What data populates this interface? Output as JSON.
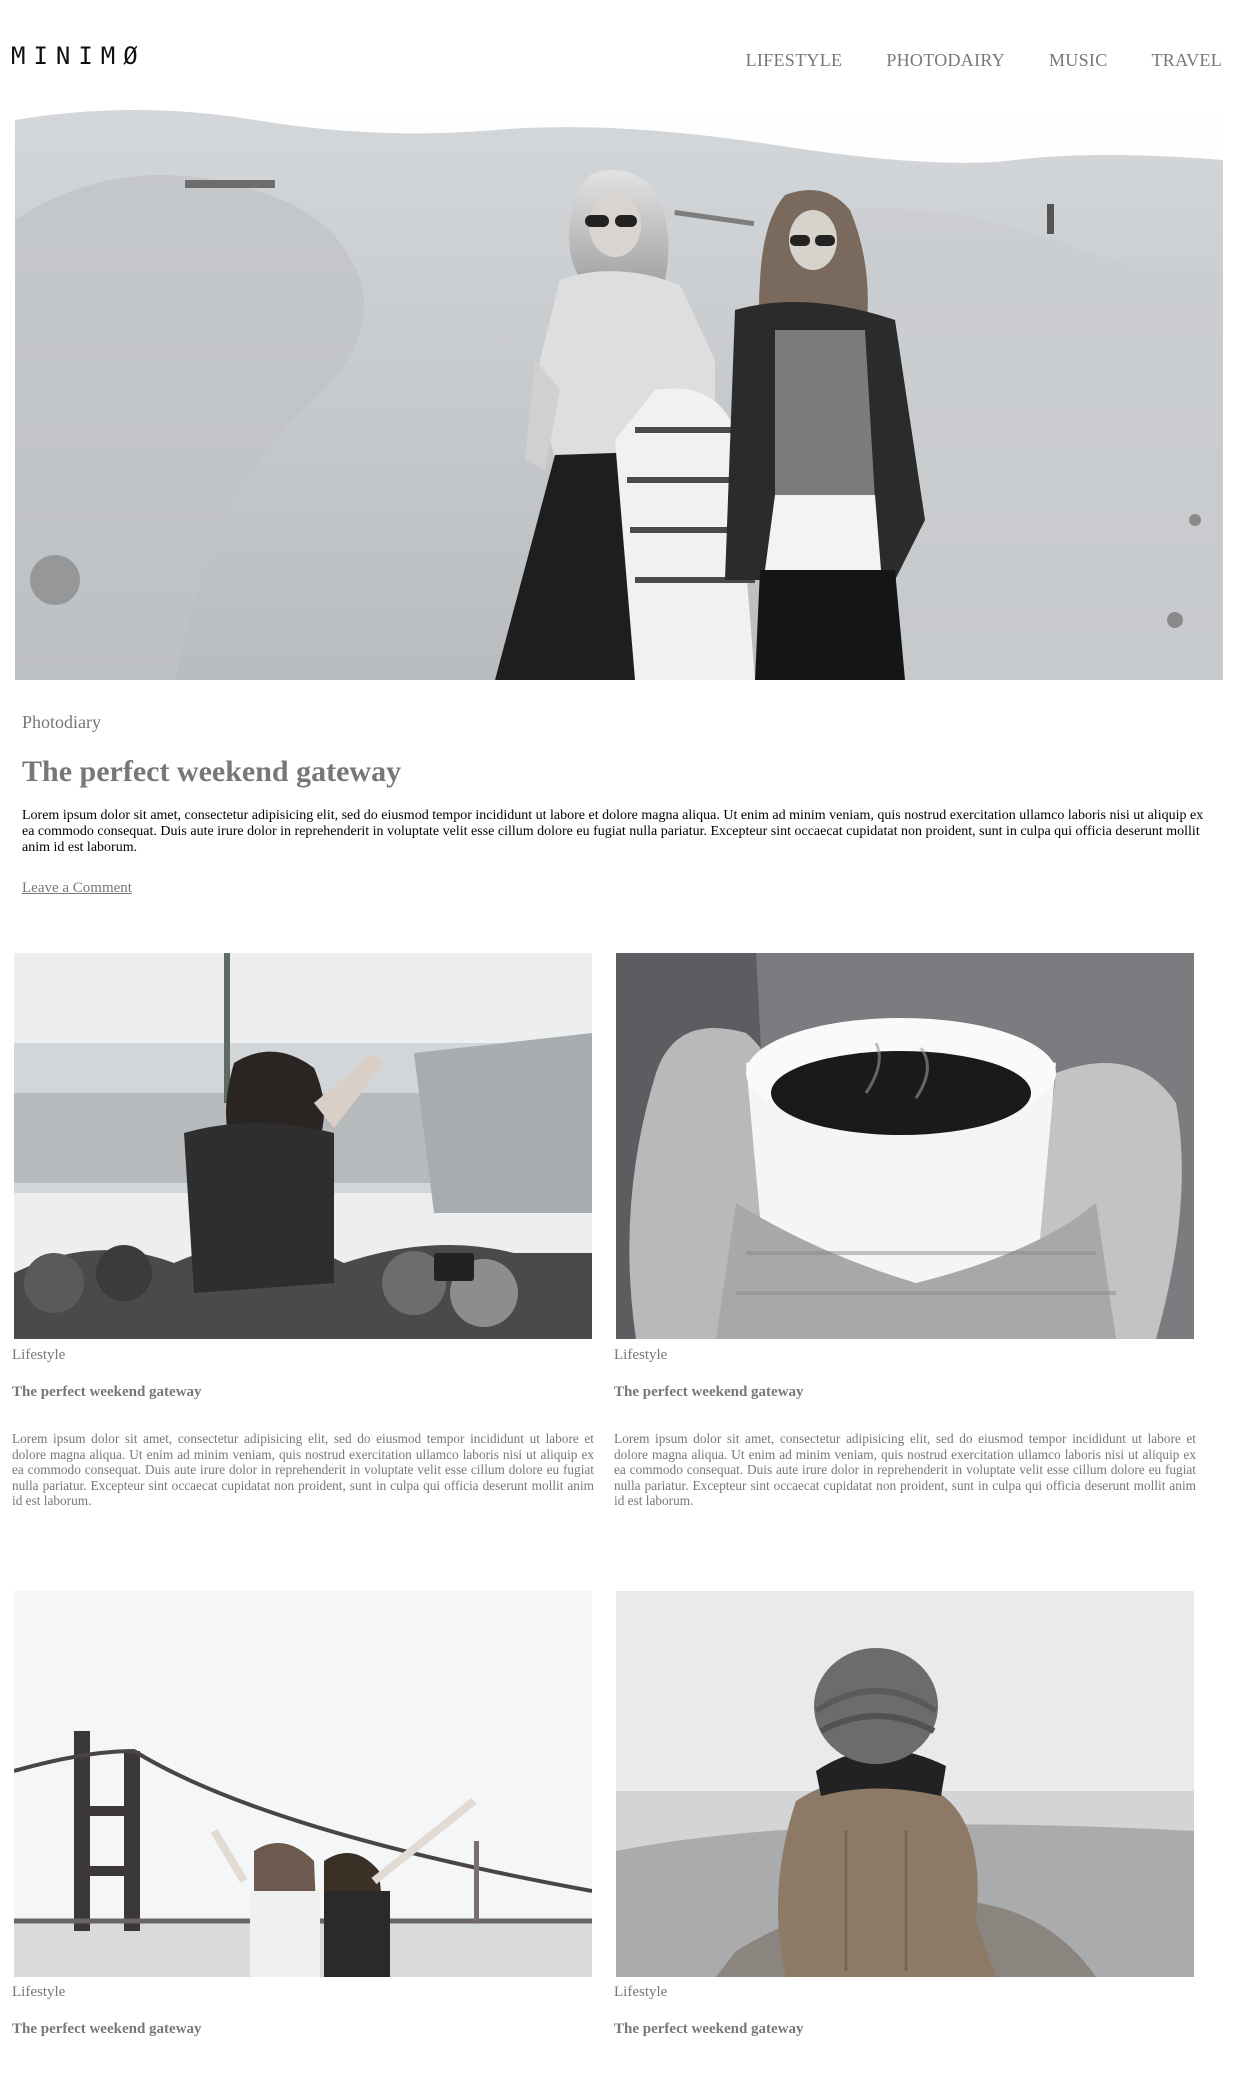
{
  "header": {
    "logo": "MINIMØ",
    "nav": [
      "LIFESTYLE",
      "PHOTODAIRY",
      "MUSIC",
      "TRAVEL"
    ]
  },
  "hero": {
    "category": "Photodiary",
    "title": "The perfect weekend gateway",
    "excerpt": "Lorem ipsum dolor sit amet, consectetur adipisicing elit, sed do eiusmod tempor incididunt ut labore et dolore magna aliqua. Ut enim ad minim veniam, quis nostrud exercitation ullamco laboris nisi ut aliquip ex ea commodo consequat. Duis aute irure dolor in reprehenderit in voluptate velit esse cillum dolore eu fugiat nulla pariatur. Excepteur sint occaecat cupidatat non proident, sunt in culpa qui officia deserunt mollit anim id est laborum.",
    "comment_link": "Leave a Comment"
  },
  "posts": [
    {
      "category": "Lifestyle",
      "title": "The perfect weekend gateway",
      "excerpt": "Lorem ipsum dolor sit amet, consectetur adipisicing elit, sed do eiusmod tempor incididunt ut labore et dolore magna aliqua. Ut enim ad minim veniam, quis nostrud exercitation ullamco laboris nisi ut aliquip ex ea commodo consequat. Duis aute irure dolor in reprehenderit in voluptate velit esse cillum dolore eu fugiat nulla pariatur. Excepteur sint occaecat cupidatat non proident, sunt in culpa qui officia deserunt mollit anim id est laborum."
    },
    {
      "category": "Lifestyle",
      "title": "The perfect weekend gateway",
      "excerpt": "Lorem ipsum dolor sit amet, consectetur adipisicing elit, sed do eiusmod tempor incididunt ut labore et dolore magna aliqua. Ut enim ad minim veniam, quis nostrud exercitation ullamco laboris nisi ut aliquip ex ea commodo consequat. Duis aute irure dolor in reprehenderit in voluptate velit esse cillum dolore eu fugiat nulla pariatur. Excepteur sint occaecat cupidatat non proident, sunt in culpa qui officia deserunt mollit anim id est laborum."
    },
    {
      "category": "Lifestyle",
      "title": "The perfect weekend gateway"
    },
    {
      "category": "Lifestyle",
      "title": "The perfect weekend gateway"
    }
  ]
}
